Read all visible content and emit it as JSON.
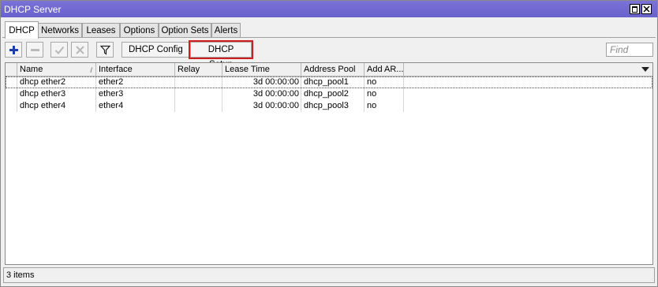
{
  "window": {
    "title": "DHCP Server"
  },
  "tabs": [
    {
      "label": "DHCP",
      "active": true
    },
    {
      "label": "Networks"
    },
    {
      "label": "Leases"
    },
    {
      "label": "Options"
    },
    {
      "label": "Option Sets"
    },
    {
      "label": "Alerts"
    }
  ],
  "toolbar": {
    "add_icon": "plus-icon",
    "remove_icon": "minus-icon",
    "enable_icon": "check-icon",
    "disable_icon": "x-icon",
    "filter_icon": "funnel-icon",
    "dhcp_config_label": "DHCP Config",
    "dhcp_setup_label": "DHCP Setup",
    "find_placeholder": "Find",
    "highlight_color": "#d01c1c"
  },
  "table": {
    "columns": [
      "Name",
      "Interface",
      "Relay",
      "Lease Time",
      "Address Pool",
      "Add AR..."
    ],
    "rows": [
      [
        "dhcp ether2",
        "ether2",
        "",
        "3d 00:00:00",
        "dhcp_pool1",
        "no"
      ],
      [
        "dhcp ether3",
        "ether3",
        "",
        "3d 00:00:00",
        "dhcp_pool2",
        "no"
      ],
      [
        "dhcp ether4",
        "ether4",
        "",
        "3d 00:00:00",
        "dhcp_pool3",
        "no"
      ]
    ]
  },
  "status": {
    "text": "3 items"
  }
}
